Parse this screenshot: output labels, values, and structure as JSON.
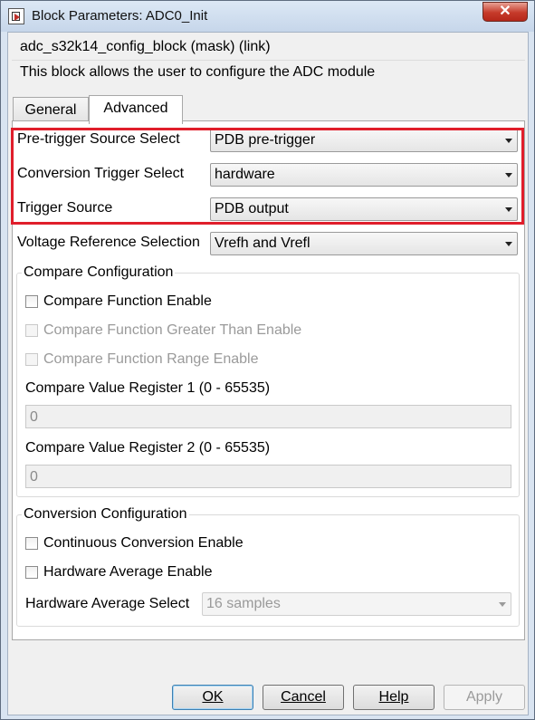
{
  "window": {
    "title": "Block Parameters: ADC0_Init",
    "close_label": "✕"
  },
  "header": {
    "block_name": "adc_s32k14_config_block (mask) (link)",
    "description": "This block allows the user to configure the ADC module"
  },
  "tabs": [
    {
      "label": "General"
    },
    {
      "label": "Advanced"
    }
  ],
  "params": {
    "pretrigger": {
      "label": "Pre-trigger Source Select",
      "value": "PDB pre-trigger"
    },
    "conversion_trigger": {
      "label": "Conversion Trigger Select",
      "value": "hardware"
    },
    "trigger_source": {
      "label": "Trigger Source",
      "value": "PDB output"
    },
    "voltage_ref": {
      "label": "Voltage Reference Selection",
      "value": "Vrefh and Vrefl"
    }
  },
  "compare": {
    "title": "Compare Configuration",
    "function_enable": "Compare Function Enable",
    "greater_than_enable": "Compare Function Greater Than Enable",
    "range_enable": "Compare Function Range Enable",
    "reg1_label": "Compare Value Register 1 (0 - 65535)",
    "reg1_value": "0",
    "reg2_label": "Compare Value Register 2 (0 - 65535)",
    "reg2_value": "0"
  },
  "conversion": {
    "title": "Conversion Configuration",
    "continuous": "Continuous Conversion Enable",
    "hw_avg_enable": "Hardware Average Enable",
    "hw_avg_select_label": "Hardware Average Select",
    "hw_avg_select_value": "16 samples"
  },
  "buttons": {
    "ok": "OK",
    "cancel": "Cancel",
    "help": "Help",
    "apply": "Apply"
  },
  "colors": {
    "highlight": "#e01e2b",
    "close": "#c63a2a"
  }
}
